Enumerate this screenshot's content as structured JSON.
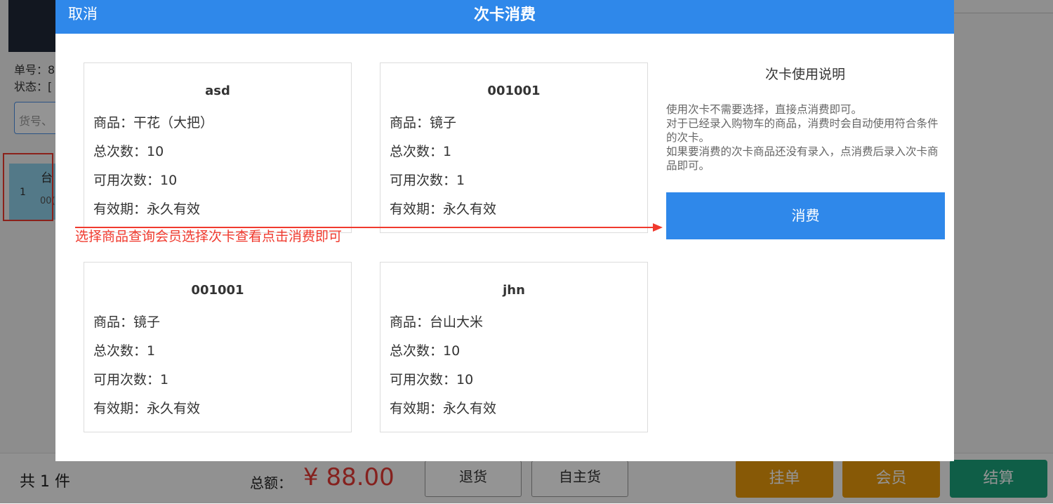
{
  "background": {
    "order_label": "单号：8",
    "status_label": "状态：[",
    "search_placeholder": "货号、",
    "item_title": "台",
    "item_qty": "1",
    "item_code": "00(",
    "count_text": "共 1 件",
    "total_label": "总额：",
    "total_value": "¥ 88.00",
    "btn_left1": "退货",
    "btn_left2": "自主货",
    "btn_hold": "挂单",
    "btn_member": "会员",
    "btn_checkout": "结算",
    "colors": {
      "orange": "#e89a0c",
      "green": "#1ba37a"
    }
  },
  "dialog": {
    "cancel_label": "取消",
    "title": "次卡消费",
    "labels": {
      "product": "商品：",
      "total_times": "总次数：",
      "available_times": "可用次数：",
      "validity": "有效期："
    },
    "cards": [
      {
        "name": "asd",
        "product": "干花（大把）",
        "total": "10",
        "available": "10",
        "validity": "永久有效"
      },
      {
        "name": "001001",
        "product": "镜子",
        "total": "1",
        "available": "1",
        "validity": "永久有效"
      },
      {
        "name": "001001",
        "product": "镜子",
        "total": "1",
        "available": "1",
        "validity": "永久有效"
      },
      {
        "name": "jhn",
        "product": "台山大米",
        "total": "10",
        "available": "10",
        "validity": "永久有效"
      }
    ],
    "info_title": "次卡使用说明",
    "info_lines": [
      "使用次卡不需要选择，直接点消费即可。",
      "对于已经录入购物车的商品，消费时会自动使用符合条件的次卡。",
      "如果要消费的次卡商品还没有录入，点消费后录入次卡商品即可。"
    ],
    "consume_label": "消费",
    "accent": "#2f88ea"
  },
  "annotation": {
    "text": "选择商品查询会员选择次卡查看点击消费即可",
    "color": "#f03a2e"
  }
}
